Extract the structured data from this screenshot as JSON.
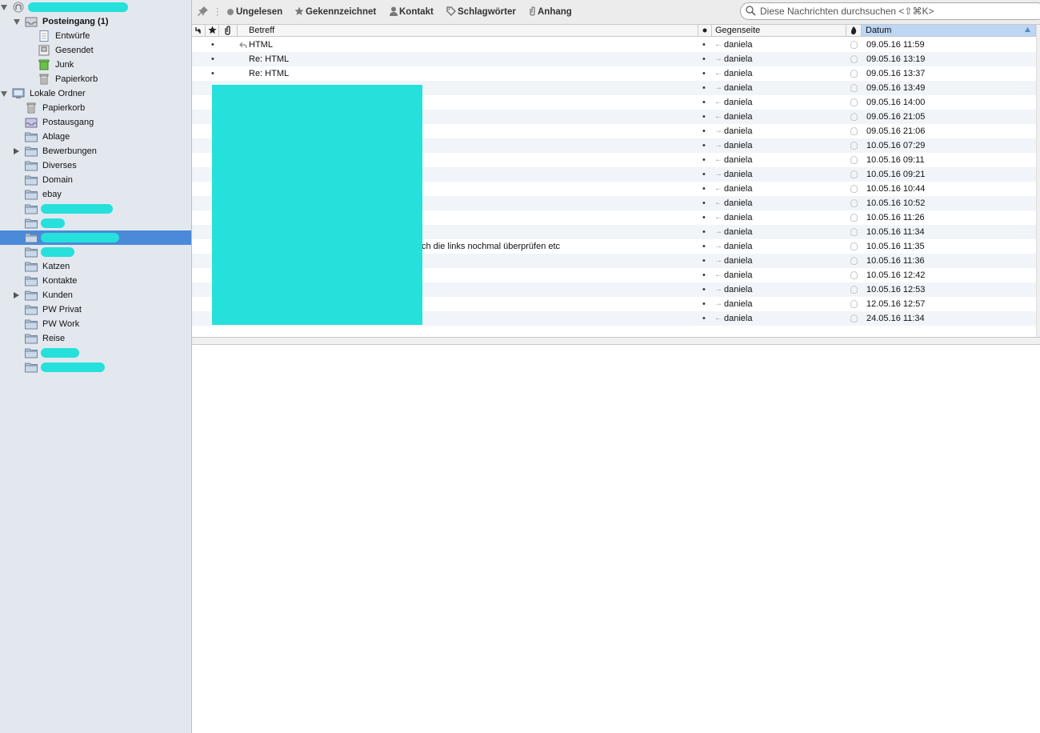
{
  "sidebar": {
    "folders": [
      {
        "label": "",
        "redacted": true,
        "icon": "account-icon",
        "twisty": "down",
        "indent": 0,
        "bold": false
      },
      {
        "label": "Posteingang (1)",
        "icon": "inbox-icon",
        "twisty": "down",
        "indent": 1,
        "bold": true
      },
      {
        "label": "Entwürfe",
        "icon": "drafts-icon",
        "twisty": "",
        "indent": 2,
        "bold": false
      },
      {
        "label": "Gesendet",
        "icon": "sent-icon",
        "twisty": "",
        "indent": 2,
        "bold": false
      },
      {
        "label": "Junk",
        "icon": "junk-icon",
        "twisty": "",
        "indent": 2,
        "bold": false
      },
      {
        "label": "Papierkorb",
        "icon": "trash-icon",
        "twisty": "",
        "indent": 2,
        "bold": false
      },
      {
        "label": "Lokale Ordner",
        "icon": "local-folders-icon",
        "twisty": "down",
        "indent": 0,
        "bold": false
      },
      {
        "label": "Papierkorb",
        "icon": "trash-icon",
        "twisty": "",
        "indent": 1,
        "bold": false
      },
      {
        "label": "Postausgang",
        "icon": "outbox-icon",
        "twisty": "",
        "indent": 1,
        "bold": false
      },
      {
        "label": "Ablage",
        "icon": "folder-icon",
        "twisty": "",
        "indent": 1,
        "bold": false
      },
      {
        "label": "Bewerbungen",
        "icon": "folder-icon",
        "twisty": "right",
        "indent": 1,
        "bold": false
      },
      {
        "label": "Diverses",
        "icon": "folder-icon",
        "twisty": "",
        "indent": 1,
        "bold": false
      },
      {
        "label": "Domain",
        "icon": "folder-icon",
        "twisty": "",
        "indent": 1,
        "bold": false
      },
      {
        "label": "ebay",
        "icon": "folder-icon",
        "twisty": "",
        "indent": 1,
        "bold": false
      },
      {
        "label": "",
        "redacted": true,
        "icon": "folder-icon",
        "twisty": "",
        "indent": 1,
        "bold": false
      },
      {
        "label": "",
        "redacted": true,
        "icon": "folder-icon",
        "twisty": "",
        "indent": 1,
        "bold": false
      },
      {
        "label": "",
        "redacted": true,
        "icon": "folder-icon",
        "twisty": "",
        "indent": 1,
        "bold": false,
        "selected": true
      },
      {
        "label": "",
        "redacted": true,
        "icon": "folder-icon",
        "twisty": "",
        "indent": 1,
        "bold": false
      },
      {
        "label": "Katzen",
        "icon": "folder-icon",
        "twisty": "",
        "indent": 1,
        "bold": false
      },
      {
        "label": "Kontakte",
        "icon": "folder-icon",
        "twisty": "",
        "indent": 1,
        "bold": false
      },
      {
        "label": "Kunden",
        "icon": "folder-icon",
        "twisty": "right",
        "indent": 1,
        "bold": false
      },
      {
        "label": "PW Privat",
        "icon": "folder-icon",
        "twisty": "",
        "indent": 1,
        "bold": false
      },
      {
        "label": "PW Work",
        "icon": "folder-icon",
        "twisty": "",
        "indent": 1,
        "bold": false
      },
      {
        "label": "Reise",
        "icon": "folder-icon",
        "twisty": "",
        "indent": 1,
        "bold": false
      },
      {
        "label": "",
        "redacted": true,
        "icon": "folder-icon",
        "twisty": "",
        "indent": 1,
        "bold": false
      },
      {
        "label": "",
        "redacted": true,
        "icon": "folder-icon",
        "twisty": "",
        "indent": 1,
        "bold": false
      }
    ]
  },
  "toolbar": {
    "pin_icon": "pin-icon",
    "unread_label": "Ungelesen",
    "starred_label": "Gekennzeichnet",
    "contact_label": "Kontakt",
    "tags_label": "Schlagwörter",
    "attachment_label": "Anhang",
    "search_placeholder": "Diese Nachrichten durchsuchen <⇧⌘K>"
  },
  "columns": {
    "subject": "Betreff",
    "correspondent": "Gegenseite",
    "date": "Datum"
  },
  "messages": [
    {
      "subject": "HTML",
      "reply_icon": true,
      "correspondent": "daniela",
      "direction": "in",
      "date": "09.05.16 11:59"
    },
    {
      "subject": "Re: HTML",
      "correspondent": "daniela",
      "direction": "out",
      "date": "09.05.16 13:19"
    },
    {
      "subject": "Re: HTML",
      "correspondent": "daniela",
      "direction": "in",
      "date": "09.05.16 13:37"
    },
    {
      "subject": "",
      "correspondent": "daniela",
      "direction": "out",
      "date": "09.05.16 13:49"
    },
    {
      "subject": "",
      "correspondent": "daniela",
      "direction": "in",
      "date": "09.05.16 14:00"
    },
    {
      "subject": "",
      "correspondent": "daniela",
      "direction": "in",
      "date": "09.05.16 21:05"
    },
    {
      "subject": "",
      "correspondent": "daniela",
      "direction": "out",
      "date": "09.05.16 21:06"
    },
    {
      "subject": "",
      "correspondent": "daniela",
      "direction": "out",
      "date": "10.05.16 07:29"
    },
    {
      "subject": "",
      "correspondent": "daniela",
      "direction": "in",
      "date": "10.05.16 09:11"
    },
    {
      "subject": "",
      "correspondent": "daniela",
      "direction": "out",
      "date": "10.05.16 09:21"
    },
    {
      "subject": "",
      "correspondent": "daniela",
      "direction": "in",
      "date": "10.05.16 10:44"
    },
    {
      "subject": "",
      "correspondent": "daniela",
      "direction": "in",
      "date": "10.05.16 10:52"
    },
    {
      "subject": "",
      "correspondent": "daniela",
      "direction": "in",
      "date": "10.05.16 11:26"
    },
    {
      "subject": "",
      "correspondent": "daniela",
      "direction": "out",
      "date": "10.05.16 11:34"
    },
    {
      "subject": "ch die links nochmal überprüfen etc",
      "correspondent": "daniela",
      "direction": "out",
      "date": "10.05.16 11:35"
    },
    {
      "subject": "",
      "correspondent": "daniela",
      "direction": "out",
      "date": "10.05.16 11:36"
    },
    {
      "subject": "",
      "correspondent": "daniela",
      "direction": "in",
      "date": "10.05.16 12:42"
    },
    {
      "subject": "",
      "correspondent": "daniela",
      "direction": "out",
      "date": "10.05.16 12:53"
    },
    {
      "subject": "",
      "correspondent": "daniela",
      "direction": "out",
      "date": "12.05.16 12:57"
    },
    {
      "subject": "",
      "correspondent": "daniela",
      "direction": "in",
      "date": "24.05.16 11:34"
    }
  ],
  "colors": {
    "sidebar_bg": "#e3e8ef",
    "selected_bg": "#4a8ad9",
    "redaction": "#25e0db",
    "sorted_header": "#bcd6f4"
  }
}
